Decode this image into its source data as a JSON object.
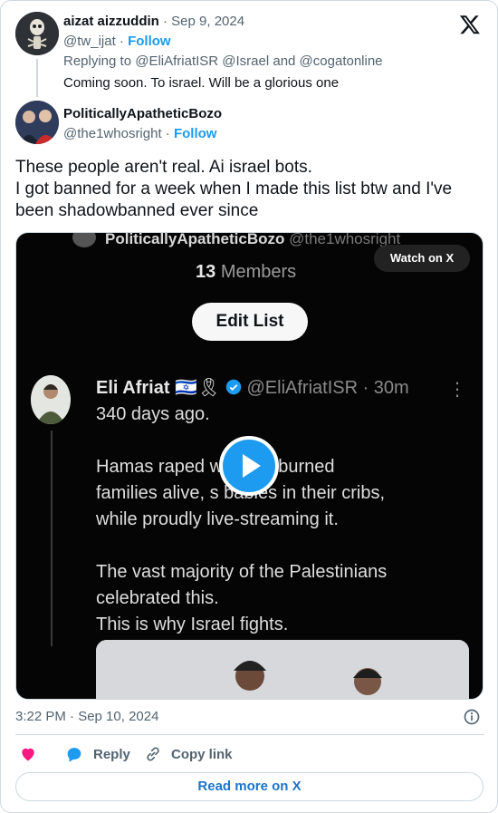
{
  "reply_tweet": {
    "name": "aizat aizzuddin",
    "date": "· Sep 9, 2024",
    "handle": "@tw_ijat",
    "follow_label": "Follow",
    "replying_to": "Replying to @EliAfriatISR @Israel and @cogatonline",
    "text": "Coming soon. To israel. Will be a glorious one"
  },
  "main_tweet": {
    "name": "PoliticallyApatheticBozo",
    "handle": "@the1whosright",
    "follow_label": "Follow",
    "text_lines": [
      "These people aren't real. Ai israel bots.",
      "I got banned for a week when I made this list btw and I've",
      "been shadowbanned ever since"
    ],
    "timestamp": "3:22 PM · Sep 10, 2024"
  },
  "video": {
    "watch_label": "Watch on X",
    "top_name": "PoliticallyApatheticBozo",
    "top_handle": "@the1whosright",
    "members_count": "13",
    "members_label": "Members",
    "edit_list_label": "Edit List",
    "inner_name": "Eli Afriat",
    "inner_flags": "🇮🇱🎗",
    "inner_handle_time": "@EliAfriatISR · 30m",
    "inner_lines": [
      "340 days ago.",
      "",
      "Hamas raped            women, burned",
      "families alive, s       babies in their cribs,",
      "while proudly live-streaming it.",
      "",
      "The vast majority of the Palestinians",
      "celebrated this.",
      "This is why Israel fights."
    ]
  },
  "actions": {
    "reply_label": "Reply",
    "copy_link_label": "Copy link",
    "read_more_label": "Read more on X"
  },
  "colors": {
    "accent": "#1d9bf0",
    "like_heart": "#f91880",
    "muted": "#536471",
    "border": "#cfd9de"
  },
  "icons": [
    "x-logo-icon",
    "verified-badge-icon",
    "play-icon",
    "info-icon",
    "heart-icon",
    "reply-bubble-icon",
    "link-icon",
    "more-dots-icon"
  ]
}
